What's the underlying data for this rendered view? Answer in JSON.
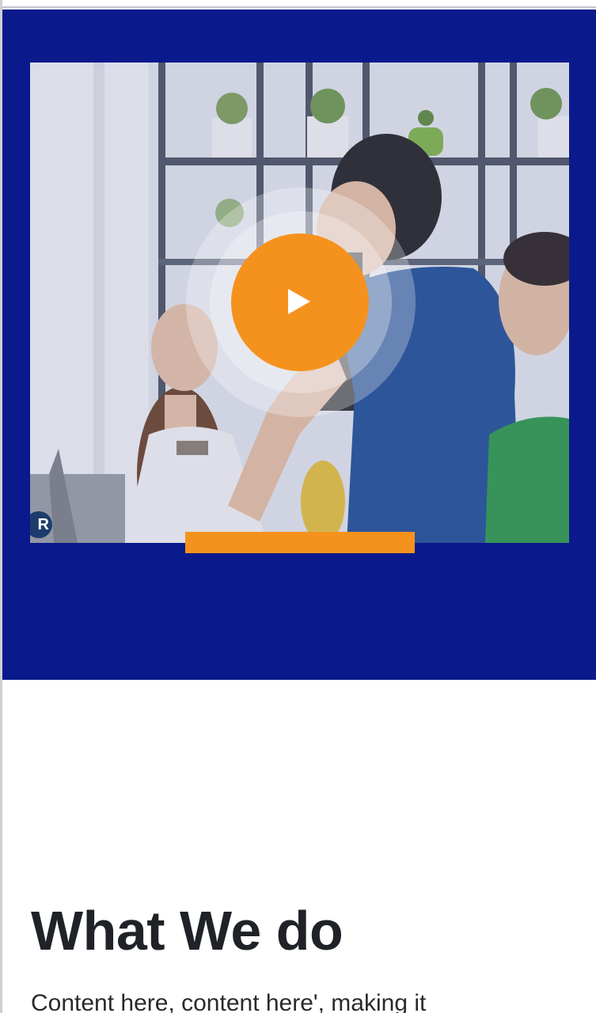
{
  "hero": {
    "video": {
      "play_label": "Play video",
      "play_icon": "play-icon",
      "logo_badge_text": "R"
    },
    "colors": {
      "background": "#0a1a8c",
      "accent": "#f5921e"
    }
  },
  "about": {
    "title": "What We do",
    "body": "Content here, content here', making it"
  }
}
